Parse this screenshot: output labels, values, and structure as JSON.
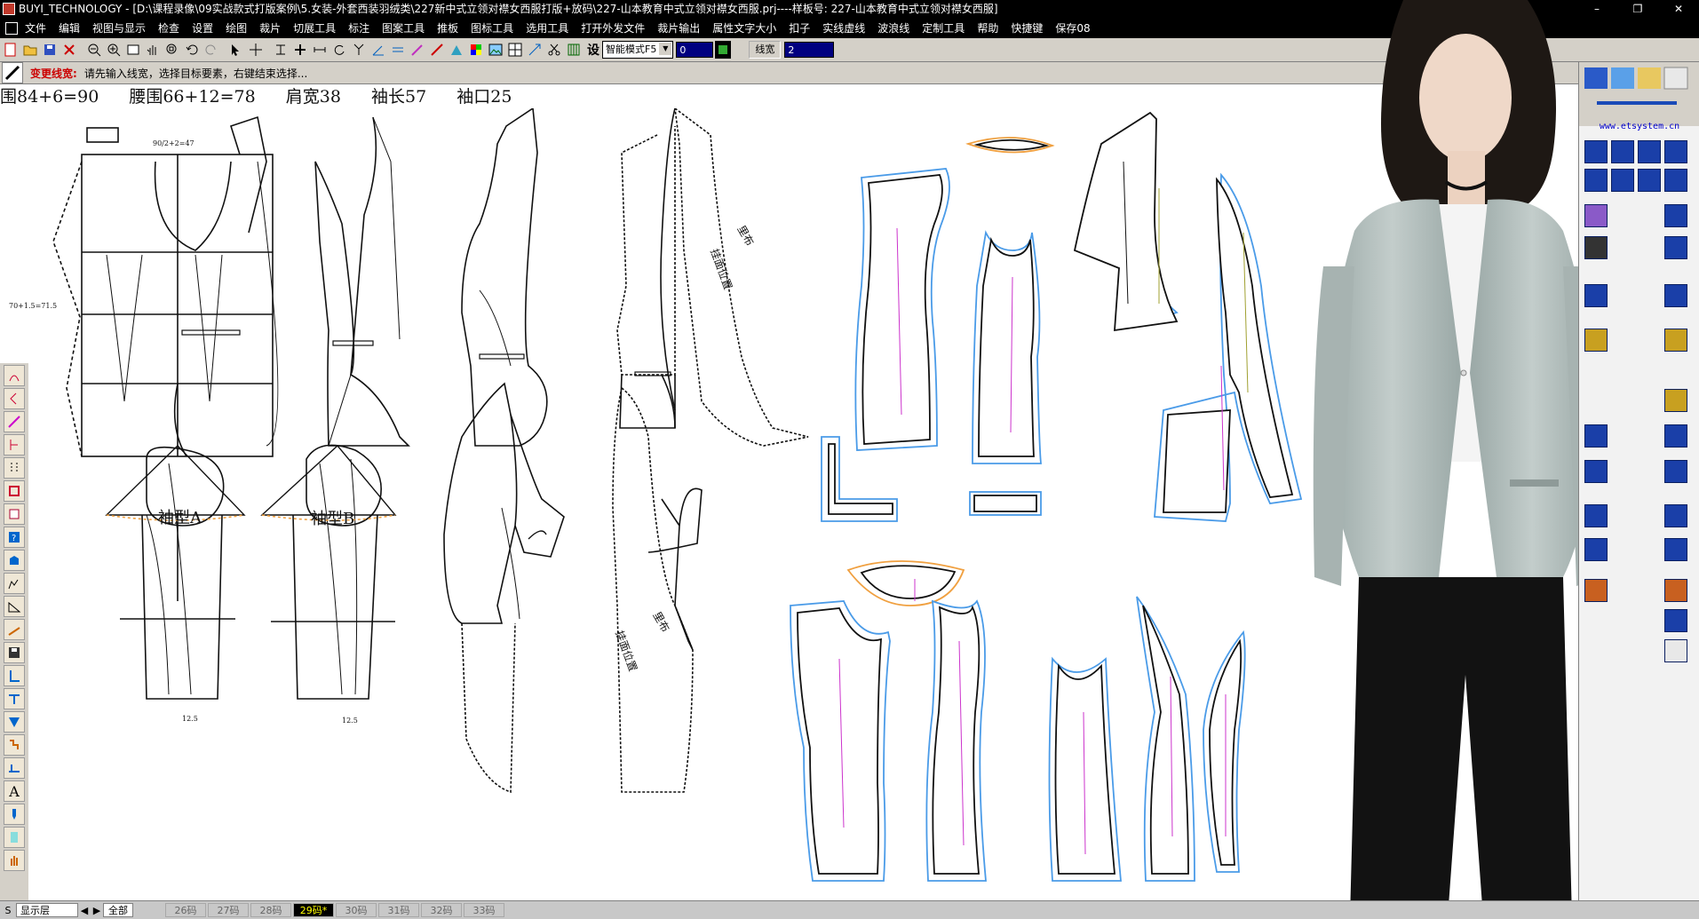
{
  "window": {
    "app_name": "BUYI_TECHNOLOGY",
    "title": "BUYI_TECHNOLOGY - [D:\\课程录像\\09实战款式打版案例\\5.女装-外套西装羽绒类\\227新中式立领对襟女西服打版+放码\\227-山本教育中式立领对襟女西服.prj----样板号: 227-山本教育中式立领对襟女西服]",
    "controls": [
      "–",
      "❐",
      "✕"
    ]
  },
  "menu": [
    "文件",
    "编辑",
    "视图与显示",
    "检查",
    "设置",
    "绘图",
    "裁片",
    "切展工具",
    "标注",
    "图案工具",
    "推板",
    "图标工具",
    "选用工具",
    "打开外发文件",
    "裁片输出",
    "属性文字大小",
    "扣子",
    "实线虚线",
    "波浪线",
    "定制工具",
    "帮助",
    "快捷键",
    "保存08"
  ],
  "toolbar": {
    "mode_select": "智能模式F5",
    "value_field": "0",
    "line_width_label": "线宽",
    "line_width_value": "2"
  },
  "prompt": {
    "tool_name": "变更线宽:",
    "message": "请先输入线宽，选择目标要素，右键结束选择..."
  },
  "measurements": [
    "围84+6=90",
    "腰围66+12=78",
    "肩宽38",
    "袖长57",
    "袖口25"
  ],
  "drawing_labels": {
    "sleeve_a": "袖型A",
    "sleeve_b": "袖型B",
    "lining": "里布",
    "facing": "挂面位置",
    "dim1": "90/2+2=47",
    "dim2": "70+1.5=71.5",
    "dim3": "12.5",
    "dim4": "12.5"
  },
  "right_panel": {
    "url": "www.etsystem.cn"
  },
  "bottom": {
    "s_label": "S",
    "layer": "显示层",
    "all": "全部",
    "sizes": [
      "26码",
      "27码",
      "28码",
      "29码*",
      "30码",
      "31码",
      "32码",
      "33码"
    ],
    "active_size": "29码*"
  },
  "colors": {
    "seam_blue": "#4a9be8",
    "grain_magenta": "#cc33cc",
    "collar_orange": "#f0a040",
    "grain_olive": "#a0a030",
    "jacket": "#b8c4c2"
  }
}
